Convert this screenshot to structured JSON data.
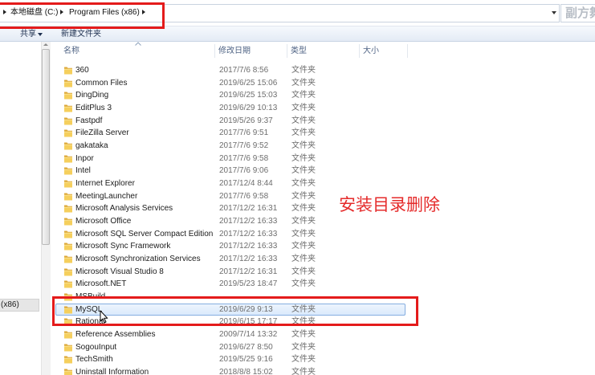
{
  "address_bar": {
    "breadcrumb": [
      "本地磁盘 (C:)",
      "Program Files (x86)"
    ],
    "search_text": "副方舞"
  },
  "toolbar": {
    "share_label": "共享",
    "new_folder_label": "新建文件夹"
  },
  "nav": {
    "selected_item": "(x86)"
  },
  "columns": {
    "name": "名称",
    "date": "修改日期",
    "type": "类型",
    "size": "大小",
    "sorted_by": "name",
    "sort_order": "ascending"
  },
  "file_list": {
    "rows": [
      {
        "name": "360",
        "date": "2017/7/6 8:56",
        "type": "文件夹"
      },
      {
        "name": "Common Files",
        "date": "2019/6/25 15:06",
        "type": "文件夹"
      },
      {
        "name": "DingDing",
        "date": "2019/6/25 15:03",
        "type": "文件夹"
      },
      {
        "name": "EditPlus 3",
        "date": "2019/6/29 10:13",
        "type": "文件夹"
      },
      {
        "name": "Fastpdf",
        "date": "2019/5/26 9:37",
        "type": "文件夹"
      },
      {
        "name": "FileZilla Server",
        "date": "2017/7/6 9:51",
        "type": "文件夹"
      },
      {
        "name": "gakataka",
        "date": "2017/7/6 9:52",
        "type": "文件夹"
      },
      {
        "name": "Inpor",
        "date": "2017/7/6 9:58",
        "type": "文件夹"
      },
      {
        "name": "Intel",
        "date": "2017/7/6 9:06",
        "type": "文件夹"
      },
      {
        "name": "Internet Explorer",
        "date": "2017/12/4 8:44",
        "type": "文件夹"
      },
      {
        "name": "MeetingLauncher",
        "date": "2017/7/6 9:58",
        "type": "文件夹"
      },
      {
        "name": "Microsoft Analysis Services",
        "date": "2017/12/2 16:31",
        "type": "文件夹"
      },
      {
        "name": "Microsoft Office",
        "date": "2017/12/2 16:33",
        "type": "文件夹"
      },
      {
        "name": "Microsoft SQL Server Compact Edition",
        "date": "2017/12/2 16:33",
        "type": "文件夹"
      },
      {
        "name": "Microsoft Sync Framework",
        "date": "2017/12/2 16:33",
        "type": "文件夹"
      },
      {
        "name": "Microsoft Synchronization Services",
        "date": "2017/12/2 16:33",
        "type": "文件夹"
      },
      {
        "name": "Microsoft Visual Studio 8",
        "date": "2017/12/2 16:31",
        "type": "文件夹"
      },
      {
        "name": "Microsoft.NET",
        "date": "2019/5/23 18:47",
        "type": "文件夹"
      },
      {
        "name": "MSBuild",
        "date": "",
        "type": ""
      },
      {
        "name": "MySQL",
        "date": "2019/6/29 9:13",
        "type": "文件夹",
        "selected": true
      },
      {
        "name": "Rational",
        "date": "2019/6/15 17:17",
        "type": "文件夹"
      },
      {
        "name": "Reference Assemblies",
        "date": "2009/7/14 13:32",
        "type": "文件夹"
      },
      {
        "name": "SogouInput",
        "date": "2019/6/27 8:50",
        "type": "文件夹"
      },
      {
        "name": "TechSmith",
        "date": "2019/5/25 9:16",
        "type": "文件夹"
      },
      {
        "name": "Uninstall Information",
        "date": "2018/8/8 15:02",
        "type": "文件夹"
      }
    ]
  },
  "annotation": {
    "text": "安装目录删除"
  },
  "icons": [
    "breadcrumb-arrow-icon",
    "dropdown-arrow-icon",
    "sort-ascending-icon",
    "scroll-up-icon",
    "folder-icon",
    "mouse-cursor-icon"
  ],
  "colors": {
    "annotation_text": "#e52b2b",
    "highlight_box": "#e41b1b",
    "selection_fill": "#d9e9fc",
    "selection_border": "#86aee0",
    "folder": "#f5cf5d"
  }
}
